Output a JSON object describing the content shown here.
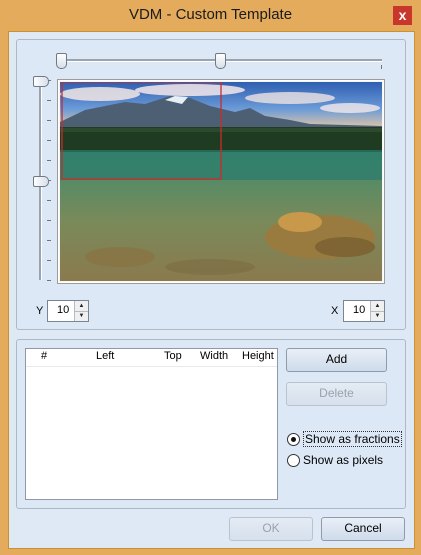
{
  "window": {
    "title": "VDM - Custom Template",
    "close_glyph": "x"
  },
  "preview": {
    "image_description_icon": "landscape-photo",
    "selection_color": "#cc2a2a"
  },
  "y_spin": {
    "label": "Y",
    "value": "10"
  },
  "x_spin": {
    "label": "X",
    "value": "10"
  },
  "list": {
    "columns": [
      "#",
      "Left",
      "Top",
      "Width",
      "Height"
    ],
    "rows": []
  },
  "buttons": {
    "add": "Add",
    "delete": "Delete",
    "ok": "OK",
    "cancel": "Cancel"
  },
  "display_mode": {
    "options": [
      "Show as fractions",
      "Show as pixels"
    ],
    "selected": "Show as fractions"
  },
  "colors": {
    "window_frame": "#e3ab5b",
    "close_button": "#c7372c",
    "client": "#dfe9f6"
  }
}
